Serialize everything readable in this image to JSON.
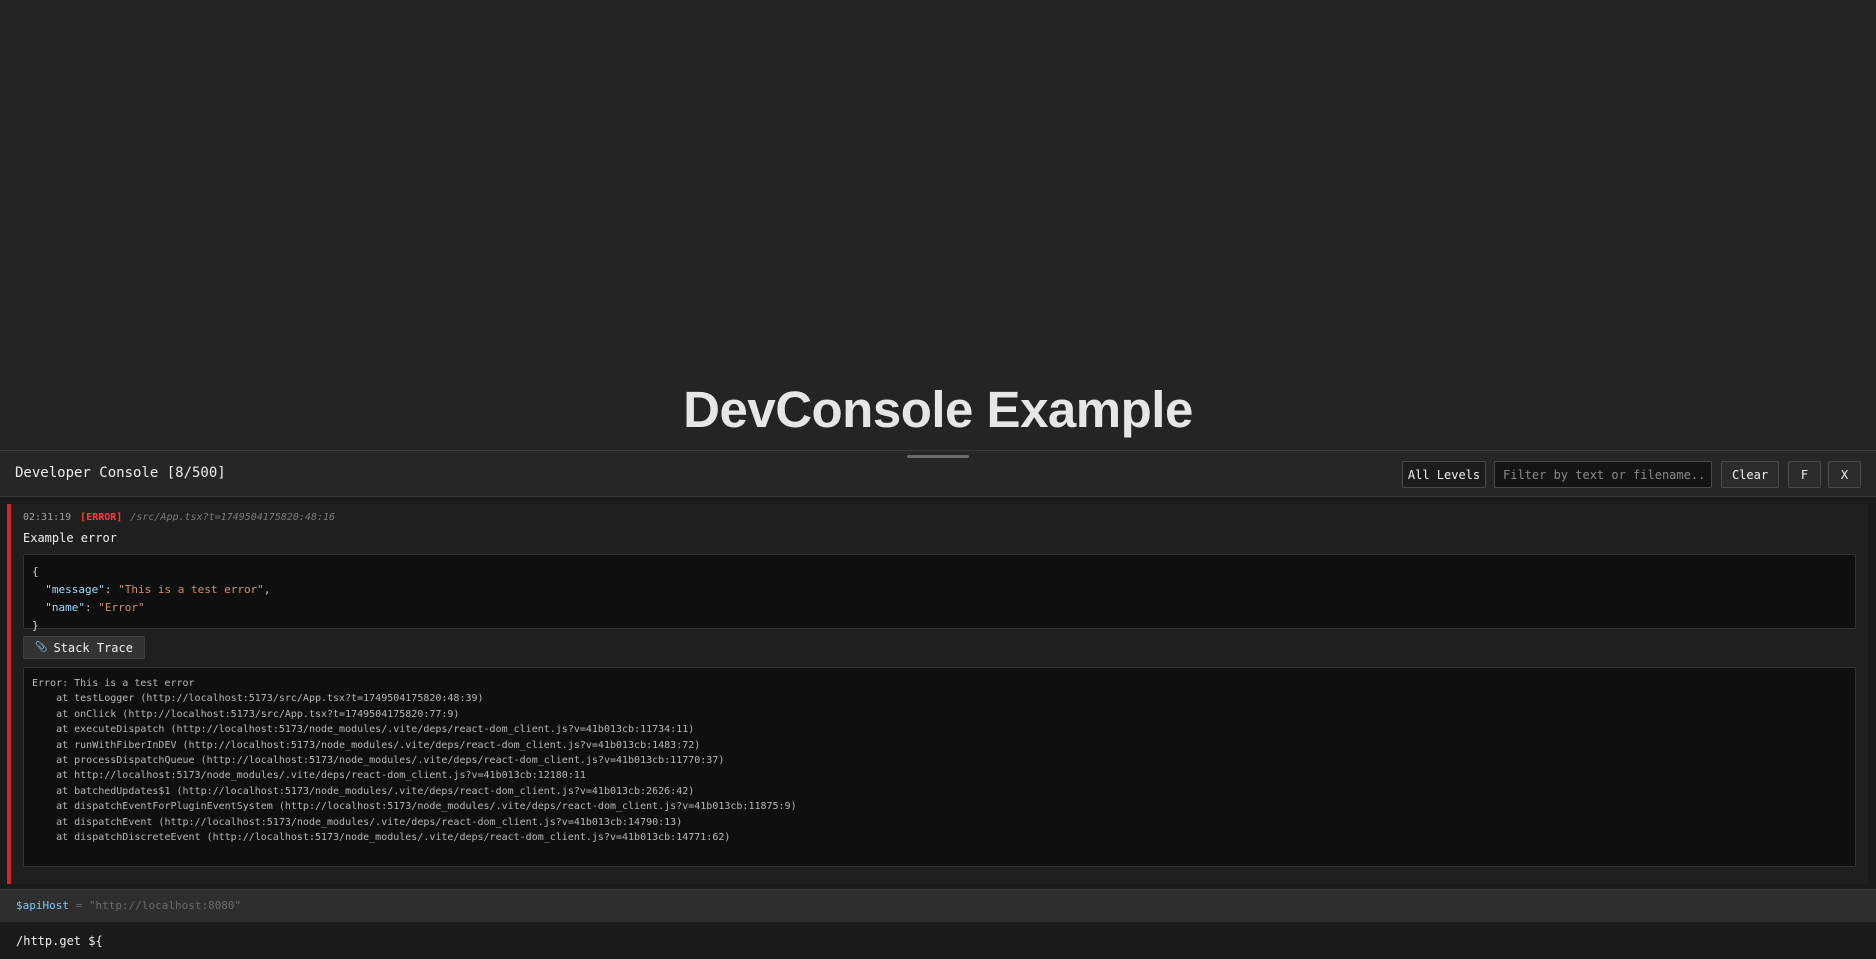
{
  "page": {
    "title": "DevConsole Example"
  },
  "console": {
    "title": "Developer Console [8/500]",
    "levels_label": "All Levels",
    "filter_placeholder": "Filter by text or filename...",
    "clear_label": "Clear",
    "f_label": "F",
    "x_label": "X"
  },
  "entry": {
    "time": "02:31:19",
    "level": "[ERROR]",
    "source": "/src/App.tsx?t=1749504175820:48:16",
    "message": "Example error",
    "json": {
      "open": "{",
      "message_key": "\"message\"",
      "message_value": "\"This is a test error\"",
      "name_key": "\"name\"",
      "name_value": "\"Error\"",
      "close": "}"
    },
    "stack_button_label": "Stack Trace",
    "stack_icon": "paperclip-icon",
    "stack_lines": [
      "Error: This is a test error",
      "    at testLogger (http://localhost:5173/src/App.tsx?t=1749504175820:48:39)",
      "    at onClick (http://localhost:5173/src/App.tsx?t=1749504175820:77:9)",
      "    at executeDispatch (http://localhost:5173/node_modules/.vite/deps/react-dom_client.js?v=41b013cb:11734:11)",
      "    at runWithFiberInDEV (http://localhost:5173/node_modules/.vite/deps/react-dom_client.js?v=41b013cb:1483:72)",
      "    at processDispatchQueue (http://localhost:5173/node_modules/.vite/deps/react-dom_client.js?v=41b013cb:11770:37)",
      "    at http://localhost:5173/node_modules/.vite/deps/react-dom_client.js?v=41b013cb:12180:11",
      "    at batchedUpdates$1 (http://localhost:5173/node_modules/.vite/deps/react-dom_client.js?v=41b013cb:2626:42)",
      "    at dispatchEventForPluginEventSystem (http://localhost:5173/node_modules/.vite/deps/react-dom_client.js?v=41b013cb:11875:9)",
      "    at dispatchEvent (http://localhost:5173/node_modules/.vite/deps/react-dom_client.js?v=41b013cb:14790:13)",
      "    at dispatchDiscreteEvent (http://localhost:5173/node_modules/.vite/deps/react-dom_client.js?v=41b013cb:14771:62)"
    ]
  },
  "variable_bar": {
    "name": "$apiHost",
    "equals": " = ",
    "value": "\"http://localhost:8080\""
  },
  "command": {
    "value": "/http.get ${"
  },
  "colors": {
    "error_accent": "#d42626",
    "error_text": "#ff3b3b",
    "json_key": "#9cdcfe",
    "json_string": "#ce9178",
    "variable_name": "#7fc8f8"
  }
}
